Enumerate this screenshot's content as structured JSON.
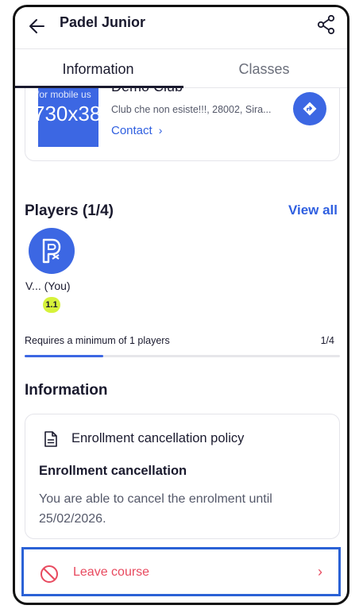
{
  "header": {
    "title": "Padel Junior",
    "back_icon": "arrow-left-icon",
    "share_icon": "share-icon"
  },
  "tabs": [
    {
      "label": "Information",
      "active": true
    },
    {
      "label": "Classes",
      "active": false
    }
  ],
  "club": {
    "image_text_small": "for mobile us",
    "image_text_big": "730x38",
    "name": "Demo Club",
    "address": "Club che non esiste!!!, 28002, Sira...",
    "contact_label": "Contact",
    "contact_chevron": "›",
    "directions_icon": "directions-icon"
  },
  "players": {
    "title": "Players (1/4)",
    "view_all": "View all",
    "list": [
      {
        "name": "V...   (You)",
        "level": "1.1"
      }
    ],
    "requires_text": "Requires a minimum of 1 players",
    "count_text": "1/4",
    "progress_fraction": 0.25
  },
  "information": {
    "title": "Information",
    "policy_heading": "Enrollment cancellation policy",
    "policy_subtitle": "Enrollment cancellation",
    "policy_text": "You are able to cancel the enrolment until 25/02/2026."
  },
  "leave": {
    "label": "Leave course",
    "chevron": "›",
    "icon": "block-icon"
  },
  "colors": {
    "primary": "#3c67e3",
    "link": "#2f5fe0",
    "danger": "#e84a5f",
    "level_badge": "#d6f23a",
    "highlight_border": "#2b62d6"
  }
}
